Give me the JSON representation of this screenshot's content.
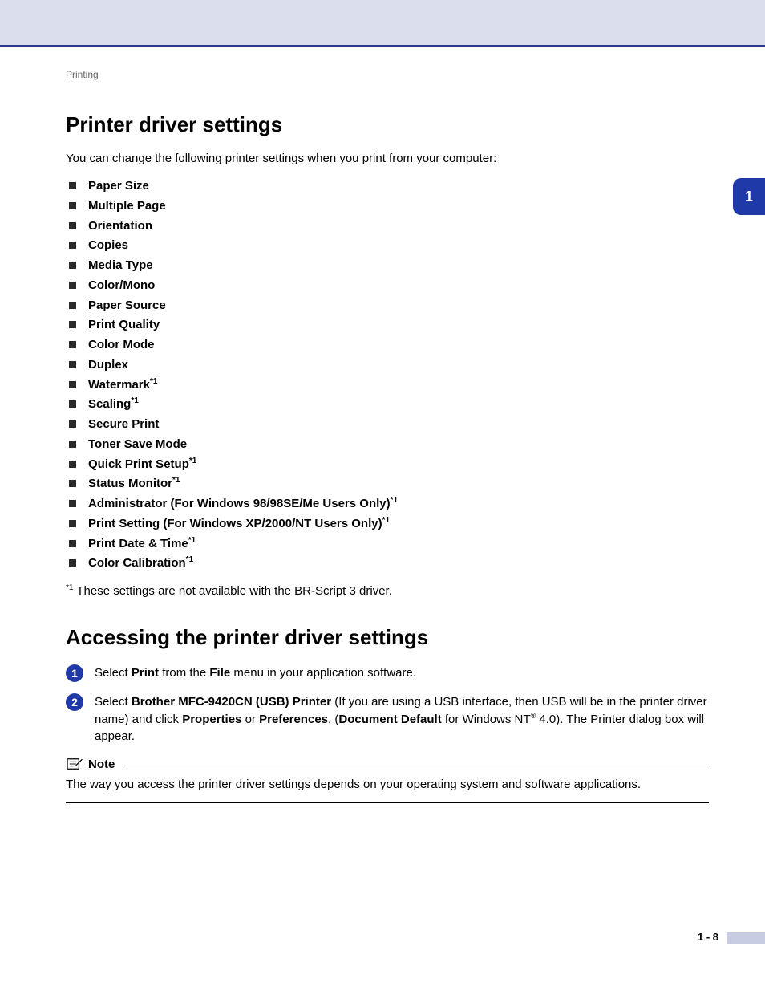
{
  "breadcrumb": "Printing",
  "section1": {
    "title": "Printer driver settings",
    "intro": "You can change the following printer settings when you print from your computer:",
    "items": [
      {
        "text": "Paper Size",
        "sup": ""
      },
      {
        "text": "Multiple Page",
        "sup": ""
      },
      {
        "text": "Orientation",
        "sup": ""
      },
      {
        "text": "Copies",
        "sup": ""
      },
      {
        "text": "Media Type",
        "sup": ""
      },
      {
        "text": "Color/Mono",
        "sup": ""
      },
      {
        "text": "Paper Source",
        "sup": ""
      },
      {
        "text": "Print Quality",
        "sup": ""
      },
      {
        "text": "Color Mode",
        "sup": ""
      },
      {
        "text": "Duplex",
        "sup": ""
      },
      {
        "text": "Watermark",
        "sup": "*1"
      },
      {
        "text": "Scaling",
        "sup": "*1"
      },
      {
        "text": "Secure Print",
        "sup": ""
      },
      {
        "text": "Toner Save Mode",
        "sup": ""
      },
      {
        "text": "Quick Print Setup",
        "sup": "*1"
      },
      {
        "text": "Status Monitor",
        "sup": "*1"
      },
      {
        "text": "Administrator (For Windows 98/98SE/Me Users Only)",
        "sup": "*1"
      },
      {
        "text": "Print Setting (For Windows XP/2000/NT Users Only)",
        "sup": "*1"
      },
      {
        "text": "Print Date & Time",
        "sup": "*1"
      },
      {
        "text": "Color Calibration",
        "sup": "*1"
      }
    ],
    "footnote_sup": "*1",
    "footnote": " These settings are not available with the BR-Script 3 driver."
  },
  "section2": {
    "title": "Accessing the printer driver settings",
    "steps": [
      {
        "num": "1",
        "parts": [
          {
            "t": "Select ",
            "b": false
          },
          {
            "t": "Print",
            "b": true
          },
          {
            "t": " from the ",
            "b": false
          },
          {
            "t": "File",
            "b": true
          },
          {
            "t": " menu in your application software.",
            "b": false
          }
        ]
      },
      {
        "num": "2",
        "parts": [
          {
            "t": "Select ",
            "b": false
          },
          {
            "t": "Brother MFC-9420CN (USB) Printer",
            "b": true
          },
          {
            "t": " (If you are using a USB interface, then USB will be in the printer driver name) and click ",
            "b": false
          },
          {
            "t": "Properties",
            "b": true
          },
          {
            "t": " or ",
            "b": false
          },
          {
            "t": "Preferences",
            "b": true
          },
          {
            "t": ". (",
            "b": false
          },
          {
            "t": "Document Default",
            "b": true
          },
          {
            "t": " for Windows NT",
            "b": false
          },
          {
            "t": "®",
            "b": false,
            "supR": true
          },
          {
            "t": " 4.0). The Printer dialog box will appear.",
            "b": false
          }
        ]
      }
    ]
  },
  "note": {
    "label": "Note",
    "text": "The way you access the printer driver settings depends on your operating system and software applications."
  },
  "sideTab": "1",
  "pageNum": "1 - 8"
}
